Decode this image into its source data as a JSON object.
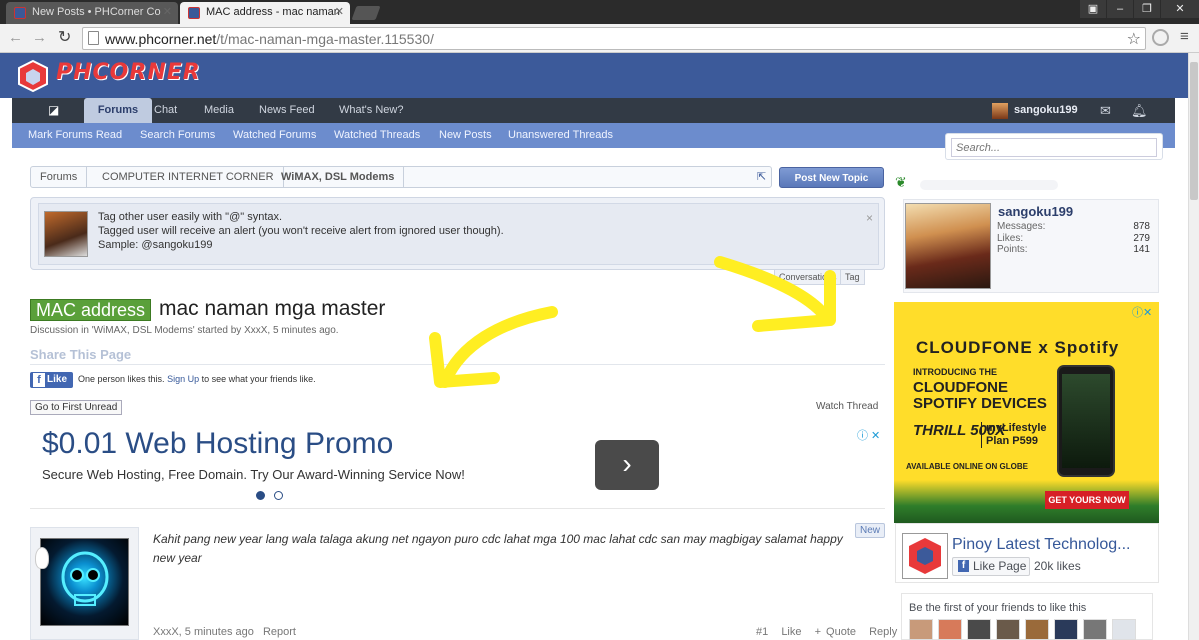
{
  "browser": {
    "tabs": [
      {
        "title": "New Posts • PHCorner Co",
        "active": false
      },
      {
        "title": "MAC address - mac naman",
        "active": true
      }
    ],
    "url_host": "www.phcorner.net",
    "url_path": "/t/mac-naman-mga-master.115530/"
  },
  "site": {
    "logo_text": "PHCORNER",
    "nav": [
      "Forums",
      "Chat",
      "Media",
      "News Feed",
      "What's New?"
    ],
    "username": "sangoku199",
    "subnav": [
      "Mark Forums Read",
      "Search Forums",
      "Watched Forums",
      "Watched Threads",
      "New Posts",
      "Unanswered Threads"
    ],
    "search_placeholder": "Search..."
  },
  "breadcrumb": [
    "Forums",
    "COMPUTER INTERNET CORNER",
    "WiMAX, DSL Modems"
  ],
  "post_new_topic": "Post New Topic",
  "notice": {
    "line1": "Tag other user easily with \"@\" syntax.",
    "line2": "Tagged user will receive an alert (you won't receive alert from ignored user though).",
    "line3": "Sample: @sangoku199",
    "close": "×",
    "tabs": [
      "Conversations",
      "Tag"
    ]
  },
  "thread": {
    "prefix": "MAC address",
    "title": "mac naman mga master",
    "description": "Discussion in 'WiMAX, DSL Modems' started by XxxX, 5 minutes ago.",
    "share_heading": "Share This Page",
    "fb_like": "Like",
    "fb_text_pre": "One person likes this.",
    "fb_signup": "Sign Up",
    "fb_text_post": "to see what your friends like.",
    "first_unread": "Go to First Unread",
    "watch": "Watch Thread"
  },
  "ad": {
    "title": "$0.01 Web Hosting Promo",
    "subtitle": "Secure Web Hosting, Free Domain. Try Our Award-Winning Service Now!"
  },
  "post": {
    "text": "Kahit pang new year lang wala talaga akung net ngayon puro cdc lahat mga 100 mac lahat cdc san may magbigay salamat happy new year",
    "new_badge": "New",
    "meta": "XxxX, 5 minutes ago",
    "report": "Report",
    "number": "#1",
    "like": "Like",
    "quote": "+ Quote",
    "reply": "Reply"
  },
  "visitor": {
    "name": "sangoku199",
    "stats": [
      {
        "label": "Messages:",
        "value": "878"
      },
      {
        "label": "Likes:",
        "value": "279"
      },
      {
        "label": "Points:",
        "value": "141"
      }
    ]
  },
  "cloudfone_ad": {
    "logo": "CLOUDFONE x Spotify",
    "intro": "INTRODUCING THE",
    "headline1": "CLOUDFONE",
    "headline2": "SPOTIFY DEVICES",
    "model": "THRILL 500X",
    "plan1": "myLifestyle",
    "plan2": "Plan P599",
    "availability": "AVAILABLE ONLINE ON GLOBE",
    "cta": "GET YOURS NOW"
  },
  "fb_page": {
    "name": "Pinoy Latest Technolog...",
    "like_button": "Like Page",
    "likes": "20k likes",
    "friends_text": "Be the first of your friends to like this"
  },
  "colors": {
    "site_header": "#3c5a9a",
    "nav_dark": "#323a45",
    "subnav": "#6c8ccd",
    "prefix_green": "#5aa03a",
    "annotation_arrow": "#ffee22",
    "ad_yellow": "#ffdd2a"
  }
}
